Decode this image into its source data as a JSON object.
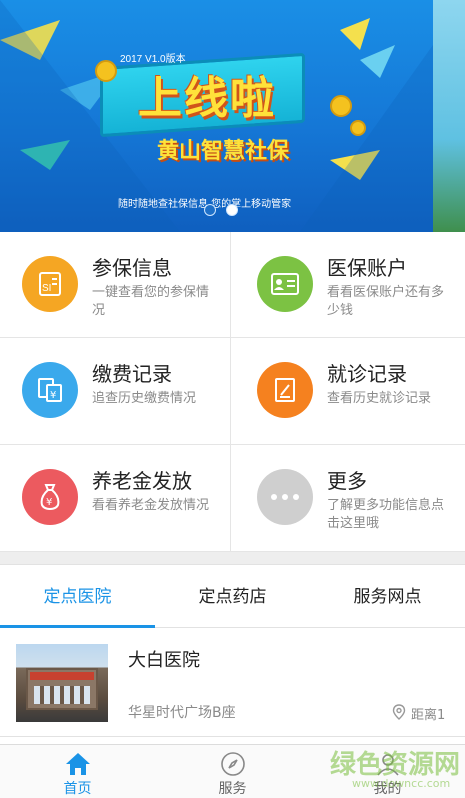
{
  "banner": {
    "version": "2017 V1.0版本",
    "headline": "上线啦",
    "subtitle": "黄山智慧社保",
    "caption": "随时随地查社保信息 您的掌上移动管家",
    "slide_count": 2,
    "active_slide": 2
  },
  "services": [
    {
      "title": "参保信息",
      "desc": "一键查看您的参保情况",
      "icon": "insurance-doc-icon",
      "color": "#f5a623"
    },
    {
      "title": "医保账户",
      "desc": "看看医保账户还有多少钱",
      "icon": "id-card-icon",
      "color": "#7cc243"
    },
    {
      "title": "缴费记录",
      "desc": "追查历史缴费情况",
      "icon": "payment-doc-icon",
      "color": "#3aa9ec"
    },
    {
      "title": "就诊记录",
      "desc": "查看历史就诊记录",
      "icon": "note-pencil-icon",
      "color": "#f5811f"
    },
    {
      "title": "养老金发放",
      "desc": "看看养老金发放情况",
      "icon": "money-bag-icon",
      "color": "#ec5a5f"
    },
    {
      "title": "更多",
      "desc": "了解更多功能信息点击这里哦",
      "icon": "more-dots-icon",
      "color": "#cfcfcf"
    }
  ],
  "tabs": [
    {
      "label": "定点医院",
      "active": true
    },
    {
      "label": "定点药店",
      "active": false
    },
    {
      "label": "服务网点",
      "active": false
    }
  ],
  "hospitals": [
    {
      "name": "大白医院",
      "address": "华星时代广场B座",
      "distance": "距离1"
    }
  ],
  "nav": [
    {
      "label": "首页",
      "icon": "home-icon",
      "active": true
    },
    {
      "label": "服务",
      "icon": "compass-icon",
      "active": false
    },
    {
      "label": "我的",
      "icon": "user-icon",
      "active": false
    }
  ],
  "watermark": {
    "text": "绿色资源网",
    "url": "www.downcc.com"
  }
}
